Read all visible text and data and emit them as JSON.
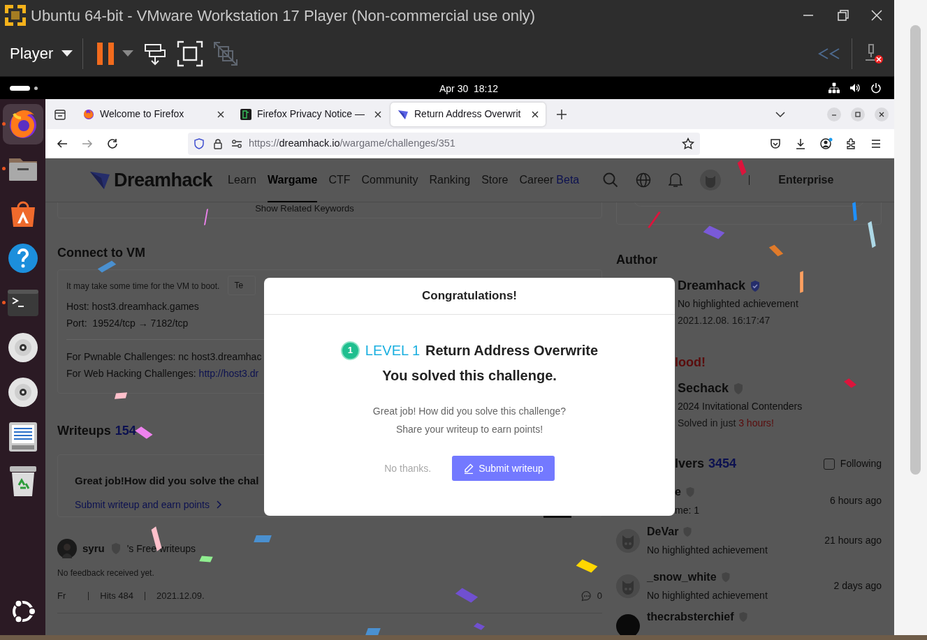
{
  "vm_window": {
    "title": "Ubuntu 64-bit - VMware Workstation 17 Player (Non-commercial use only)",
    "menu": "Player"
  },
  "top_bar": {
    "clock": "Apr 30  18:12"
  },
  "dock": [
    {
      "kind": "firefox",
      "running": true,
      "selected": true
    },
    {
      "kind": "files",
      "running": true,
      "selected": false
    },
    {
      "kind": "appcenter",
      "running": false,
      "selected": false
    },
    {
      "kind": "help",
      "running": false,
      "selected": false
    },
    {
      "kind": "terminal",
      "running": true,
      "selected": false
    },
    {
      "kind": "disc",
      "running": false,
      "selected": false
    },
    {
      "kind": "disc",
      "running": false,
      "selected": false
    },
    {
      "kind": "document",
      "running": false,
      "selected": false
    },
    {
      "kind": "trash",
      "running": false,
      "selected": false
    }
  ],
  "browser": {
    "tabs": [
      {
        "title": "Welcome to Firefox",
        "kind": "firefox",
        "selected": false
      },
      {
        "title": "Firefox Privacy Notice —",
        "kind": "notice",
        "selected": false
      },
      {
        "title": "Return Address Overwrit",
        "kind": "dreamhack",
        "selected": true
      }
    ],
    "url": {
      "scheme": "https://",
      "host": "dreamhack.io",
      "path": "/wargame/challenges/351"
    }
  },
  "site": {
    "logo": "Dreamhack",
    "nav": [
      {
        "label": "Learn",
        "selected": false
      },
      {
        "label": "Wargame",
        "selected": true
      },
      {
        "label": "CTF",
        "selected": false
      },
      {
        "label": "Community",
        "selected": false
      },
      {
        "label": "Ranking",
        "selected": false
      },
      {
        "label": "Store",
        "selected": false
      },
      {
        "label": "Career",
        "badge": "Beta",
        "selected": false
      }
    ],
    "enterprise": "Enterprise"
  },
  "keywords": "Show Related Keywords",
  "connect": {
    "heading": "Connect to VM",
    "note": "It may take some time for the VM to boot.",
    "tab": "Te",
    "host": "Host: host3.dreamhack.games",
    "port": "Port:  19524/tcp → 7182/tcp",
    "pwnable": "For Pwnable Challenges: nc host3.dreamhac",
    "web_label": "For Web Hacking Challenges: ",
    "web_link": "http://host3.dr"
  },
  "writeups": {
    "heading": "Writeups",
    "count": "154",
    "prompt": "Great job!How did you solve the chal",
    "link": "Submit writeup and earn points",
    "post": {
      "author": "syru",
      "suffix": "'s Free writeups",
      "feedback": "No feedback received yet.",
      "tag": "Fr",
      "hits": "Hits 484",
      "date": "2021.12.09.",
      "comments": "0"
    }
  },
  "author": {
    "heading": "Author",
    "name": "Dreamhack",
    "achievement": "No highlighted achievement",
    "date": "2021.12.08. 16:17:47"
  },
  "first_blood": {
    "heading": "lood!",
    "name": "Sechack",
    "achievement": "2024 Invitational Contenders",
    "solved_prefix": "Solved in just ",
    "solved_time": "3 hours",
    "solved_suffix": "!"
  },
  "solvers": {
    "heading": "lvers",
    "count": "3454",
    "following": {
      "label": "Following",
      "checked": false
    },
    "rows": [
      {
        "kind": "partial",
        "name": "e",
        "detail": "me: 1",
        "time": "6 hours ago"
      },
      {
        "kind": "full",
        "name": "DeVar",
        "detail": "No highlighted achievement",
        "time": "21 hours ago"
      },
      {
        "kind": "full",
        "name": "_snow_white",
        "detail": "No highlighted achievement",
        "time": "2 days ago"
      },
      {
        "kind": "cut",
        "name": "thecrabsterchief"
      }
    ]
  },
  "modal": {
    "title": "Congratulations!",
    "level_number": "1",
    "level": "LEVEL 1",
    "challenge": "Return Address Overwrite",
    "solved": "You solved this challenge.",
    "message": [
      "Great job! How did you solve this challenge?",
      "Share your writeup to earn points!"
    ],
    "dismiss": "No thanks.",
    "submit": "Submit writeup"
  }
}
